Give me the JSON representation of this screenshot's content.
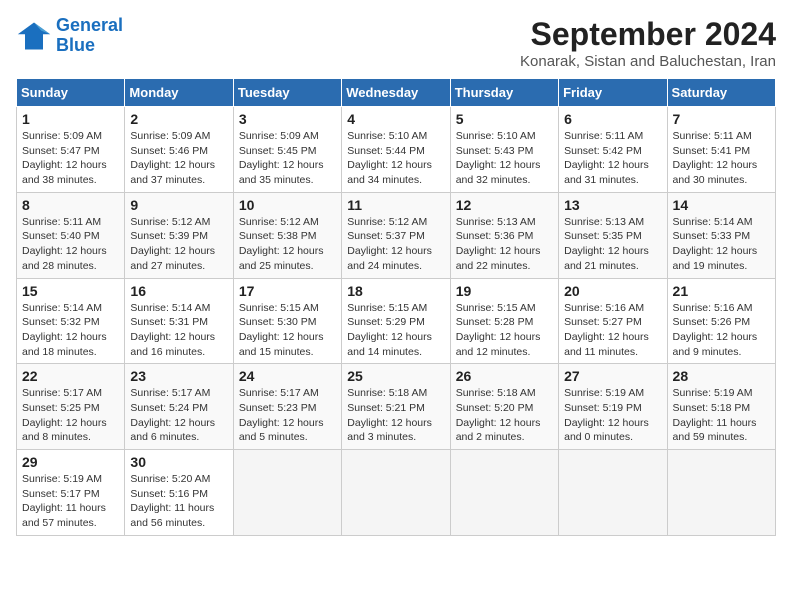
{
  "header": {
    "logo_line1": "General",
    "logo_line2": "Blue",
    "month_title": "September 2024",
    "subtitle": "Konarak, Sistan and Baluchestan, Iran"
  },
  "weekdays": [
    "Sunday",
    "Monday",
    "Tuesday",
    "Wednesday",
    "Thursday",
    "Friday",
    "Saturday"
  ],
  "weeks": [
    [
      {
        "day": "1",
        "info": "Sunrise: 5:09 AM\nSunset: 5:47 PM\nDaylight: 12 hours\nand 38 minutes."
      },
      {
        "day": "2",
        "info": "Sunrise: 5:09 AM\nSunset: 5:46 PM\nDaylight: 12 hours\nand 37 minutes."
      },
      {
        "day": "3",
        "info": "Sunrise: 5:09 AM\nSunset: 5:45 PM\nDaylight: 12 hours\nand 35 minutes."
      },
      {
        "day": "4",
        "info": "Sunrise: 5:10 AM\nSunset: 5:44 PM\nDaylight: 12 hours\nand 34 minutes."
      },
      {
        "day": "5",
        "info": "Sunrise: 5:10 AM\nSunset: 5:43 PM\nDaylight: 12 hours\nand 32 minutes."
      },
      {
        "day": "6",
        "info": "Sunrise: 5:11 AM\nSunset: 5:42 PM\nDaylight: 12 hours\nand 31 minutes."
      },
      {
        "day": "7",
        "info": "Sunrise: 5:11 AM\nSunset: 5:41 PM\nDaylight: 12 hours\nand 30 minutes."
      }
    ],
    [
      {
        "day": "8",
        "info": "Sunrise: 5:11 AM\nSunset: 5:40 PM\nDaylight: 12 hours\nand 28 minutes."
      },
      {
        "day": "9",
        "info": "Sunrise: 5:12 AM\nSunset: 5:39 PM\nDaylight: 12 hours\nand 27 minutes."
      },
      {
        "day": "10",
        "info": "Sunrise: 5:12 AM\nSunset: 5:38 PM\nDaylight: 12 hours\nand 25 minutes."
      },
      {
        "day": "11",
        "info": "Sunrise: 5:12 AM\nSunset: 5:37 PM\nDaylight: 12 hours\nand 24 minutes."
      },
      {
        "day": "12",
        "info": "Sunrise: 5:13 AM\nSunset: 5:36 PM\nDaylight: 12 hours\nand 22 minutes."
      },
      {
        "day": "13",
        "info": "Sunrise: 5:13 AM\nSunset: 5:35 PM\nDaylight: 12 hours\nand 21 minutes."
      },
      {
        "day": "14",
        "info": "Sunrise: 5:14 AM\nSunset: 5:33 PM\nDaylight: 12 hours\nand 19 minutes."
      }
    ],
    [
      {
        "day": "15",
        "info": "Sunrise: 5:14 AM\nSunset: 5:32 PM\nDaylight: 12 hours\nand 18 minutes."
      },
      {
        "day": "16",
        "info": "Sunrise: 5:14 AM\nSunset: 5:31 PM\nDaylight: 12 hours\nand 16 minutes."
      },
      {
        "day": "17",
        "info": "Sunrise: 5:15 AM\nSunset: 5:30 PM\nDaylight: 12 hours\nand 15 minutes."
      },
      {
        "day": "18",
        "info": "Sunrise: 5:15 AM\nSunset: 5:29 PM\nDaylight: 12 hours\nand 14 minutes."
      },
      {
        "day": "19",
        "info": "Sunrise: 5:15 AM\nSunset: 5:28 PM\nDaylight: 12 hours\nand 12 minutes."
      },
      {
        "day": "20",
        "info": "Sunrise: 5:16 AM\nSunset: 5:27 PM\nDaylight: 12 hours\nand 11 minutes."
      },
      {
        "day": "21",
        "info": "Sunrise: 5:16 AM\nSunset: 5:26 PM\nDaylight: 12 hours\nand 9 minutes."
      }
    ],
    [
      {
        "day": "22",
        "info": "Sunrise: 5:17 AM\nSunset: 5:25 PM\nDaylight: 12 hours\nand 8 minutes."
      },
      {
        "day": "23",
        "info": "Sunrise: 5:17 AM\nSunset: 5:24 PM\nDaylight: 12 hours\nand 6 minutes."
      },
      {
        "day": "24",
        "info": "Sunrise: 5:17 AM\nSunset: 5:23 PM\nDaylight: 12 hours\nand 5 minutes."
      },
      {
        "day": "25",
        "info": "Sunrise: 5:18 AM\nSunset: 5:21 PM\nDaylight: 12 hours\nand 3 minutes."
      },
      {
        "day": "26",
        "info": "Sunrise: 5:18 AM\nSunset: 5:20 PM\nDaylight: 12 hours\nand 2 minutes."
      },
      {
        "day": "27",
        "info": "Sunrise: 5:19 AM\nSunset: 5:19 PM\nDaylight: 12 hours\nand 0 minutes."
      },
      {
        "day": "28",
        "info": "Sunrise: 5:19 AM\nSunset: 5:18 PM\nDaylight: 11 hours\nand 59 minutes."
      }
    ],
    [
      {
        "day": "29",
        "info": "Sunrise: 5:19 AM\nSunset: 5:17 PM\nDaylight: 11 hours\nand 57 minutes."
      },
      {
        "day": "30",
        "info": "Sunrise: 5:20 AM\nSunset: 5:16 PM\nDaylight: 11 hours\nand 56 minutes."
      },
      {
        "day": "",
        "info": ""
      },
      {
        "day": "",
        "info": ""
      },
      {
        "day": "",
        "info": ""
      },
      {
        "day": "",
        "info": ""
      },
      {
        "day": "",
        "info": ""
      }
    ]
  ]
}
